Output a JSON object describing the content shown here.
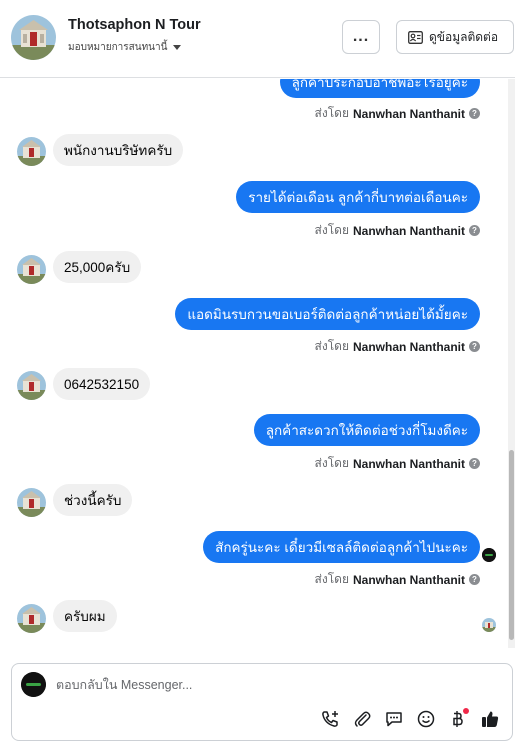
{
  "header": {
    "page_name": "Thotsaphon N Tour",
    "assign_label": "มอบหมายการสนทนานี้",
    "more_label": "...",
    "contact_label": "ดูข้อมูลติดต่อ"
  },
  "sent_prefix": "ส่งโดย",
  "agent_name": "Nanwhan Nanthanit",
  "messages": [
    {
      "dir": "out",
      "text": "ลูกค้าประกอบอาชีพอะไรอยู่คะ"
    },
    {
      "dir": "in",
      "text": "พนักงานบริษัทครับ"
    },
    {
      "dir": "out",
      "text": "รายได้ต่อเดือน ลูกค้ากี่บาทต่อเดือนคะ"
    },
    {
      "dir": "in",
      "text": "25,000ครับ"
    },
    {
      "dir": "out",
      "text": "แอดมินรบกวนขอเบอร์ติดต่อลูกค้าหน่อยได้มั้ยคะ"
    },
    {
      "dir": "in",
      "text": "0642532150"
    },
    {
      "dir": "out",
      "text": "ลูกค้าสะดวกให้ติดต่อช่วงกี่โมงดีคะ"
    },
    {
      "dir": "in",
      "text": "ช่วงนี้ครับ"
    },
    {
      "dir": "out",
      "text": "สักครู่นะคะ เดี๋ยวมีเซลล์ติดต่อลูกค้าไปนะคะ"
    },
    {
      "dir": "in",
      "text": "ครับผม"
    }
  ],
  "composer": {
    "placeholder": "ตอบกลับใน Messenger..."
  },
  "icons": [
    "phone-add-icon",
    "paperclip-icon",
    "saved-reply-icon",
    "emoji-icon",
    "baht-payment-icon",
    "like-icon"
  ],
  "colors": {
    "outgoing_bubble": "#1877f2",
    "incoming_bubble": "#f0f0f0",
    "like": "#1c1e21",
    "notification_dot": "#f02849"
  }
}
